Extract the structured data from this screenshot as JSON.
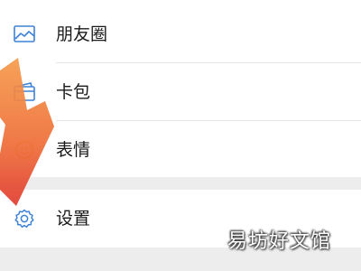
{
  "menu": {
    "items": [
      {
        "label": "朋友圈",
        "icon": "photo-icon"
      },
      {
        "label": "卡包",
        "icon": "wallet-icon"
      },
      {
        "label": "表情",
        "icon": "smiley-icon"
      }
    ],
    "settings": {
      "label": "设置",
      "icon": "gear-icon"
    }
  },
  "watermark": {
    "text": "易坊好文馆"
  },
  "colors": {
    "icon_blue": "#3d82d6",
    "arrow_orange": "#f07a3c",
    "arrow_red": "#e03a2e",
    "page_background": "#ededed"
  }
}
